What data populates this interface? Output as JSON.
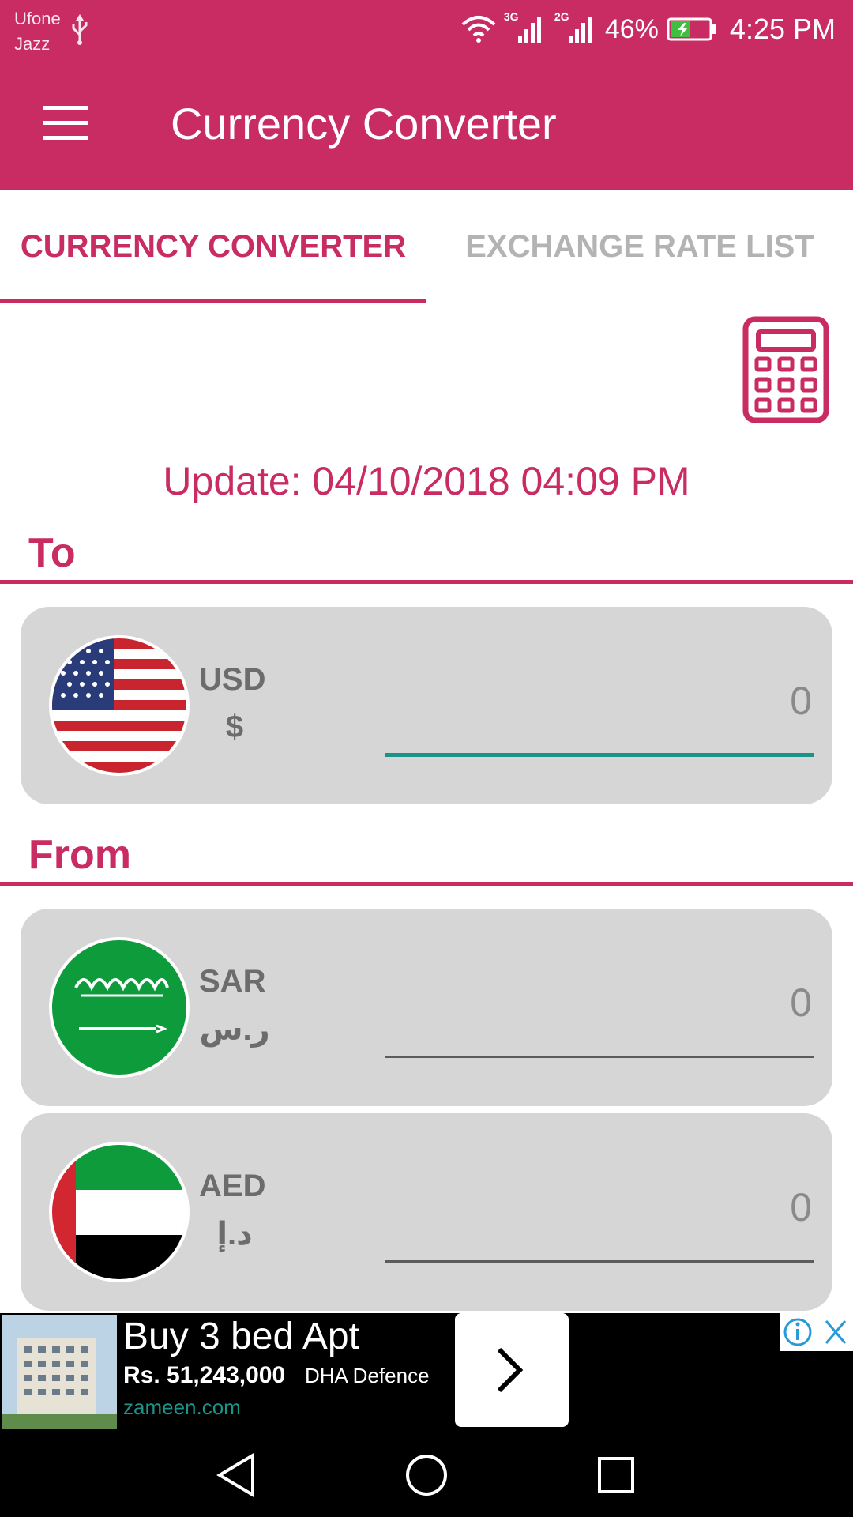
{
  "status_bar": {
    "carrier_1": "Ufone",
    "carrier_2": "Jazz",
    "network_1": "3G",
    "network_2": "2G",
    "battery": "46%",
    "time": "4:25 PM"
  },
  "app_bar": {
    "title": "Currency Converter"
  },
  "tabs": [
    {
      "label": "CURRENCY CONVERTER",
      "active": true
    },
    {
      "label": "EXCHANGE RATE LIST",
      "active": false
    }
  ],
  "update_text": "Update: 04/10/2018 04:09 PM",
  "sections": {
    "to_label": "To",
    "from_label": "From"
  },
  "to_currency": {
    "code": "USD",
    "symbol": "$",
    "value": "0"
  },
  "from_currencies": [
    {
      "code": "SAR",
      "symbol": "ر.س",
      "value": "0"
    },
    {
      "code": "AED",
      "symbol": "د.إ",
      "value": "0"
    }
  ],
  "ad": {
    "title": "Buy 3 bed Apt",
    "price": "Rs. 51,243,000",
    "location": "DHA Defence",
    "domain": "zameen.com"
  },
  "colors": {
    "primary": "#c82c63",
    "card": "#d6d6d6",
    "focus_line": "#1a9488"
  },
  "icons": [
    "menu-icon",
    "calculator-icon",
    "ad-info-icon",
    "ad-close-icon",
    "back-icon",
    "home-icon",
    "recents-icon"
  ]
}
